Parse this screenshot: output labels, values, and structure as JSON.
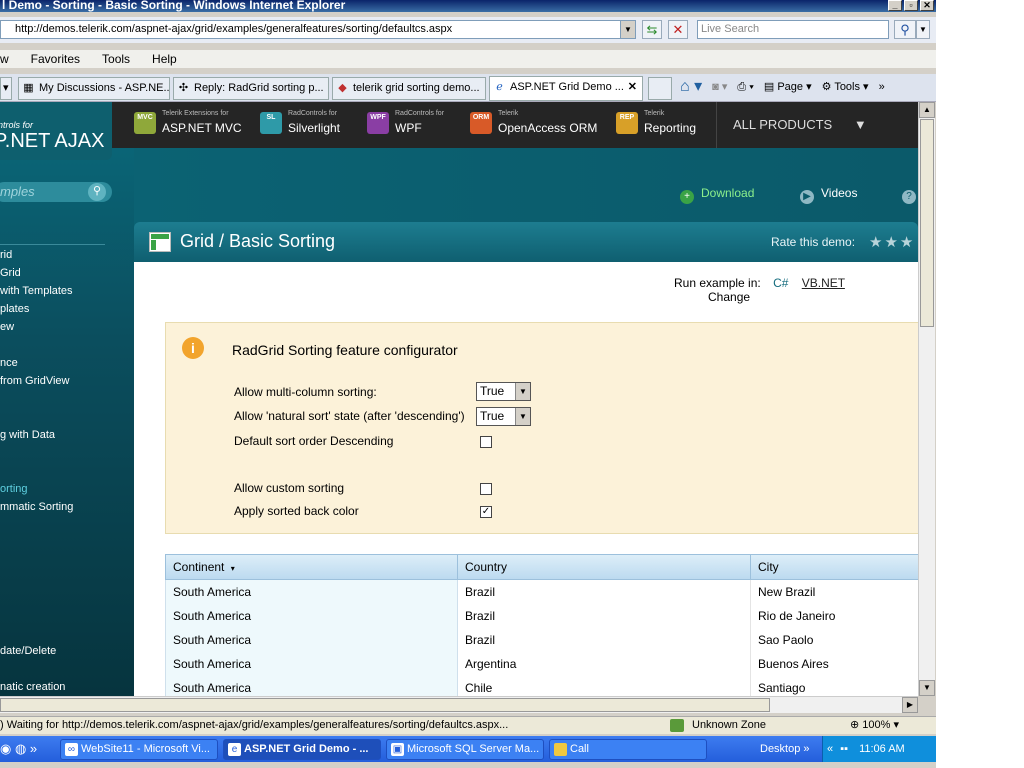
{
  "window": {
    "title": "l Demo - Sorting - Basic Sorting - Windows Internet Explorer"
  },
  "address": {
    "url": "http://demos.telerik.com/aspnet-ajax/grid/examples/generalfeatures/sorting/defaultcs.aspx"
  },
  "live_search": {
    "placeholder": "Live Search"
  },
  "menu": [
    "w",
    "Favorites",
    "Tools",
    "Help"
  ],
  "tabs": [
    {
      "label": "My Discussions - ASP.NE...",
      "icon": "forum-icon"
    },
    {
      "label": "Reply: RadGrid sorting p...",
      "icon": "reply-icon"
    },
    {
      "label": "telerik grid sorting demo...",
      "icon": "google-icon"
    },
    {
      "label": "ASP.NET Grid Demo ...",
      "icon": "ie-icon",
      "active": true
    }
  ],
  "toolbar_right": {
    "page": "Page",
    "tools": "Tools"
  },
  "site": {
    "logo_small": "ntrols for",
    "logo_big": "P.NET AJAX",
    "products": [
      {
        "badge": "MVC",
        "small": "Telerik Extensions for",
        "name": "ASP.NET MVC",
        "color": "#8fa83a"
      },
      {
        "badge": "SL",
        "small": "RadControls for",
        "name": "Silverlight",
        "color": "#2e9aa8"
      },
      {
        "badge": "WPF",
        "small": "RadControls for",
        "name": "WPF",
        "color": "#8a3ea4"
      },
      {
        "badge": "ORM",
        "small": "Telerik",
        "name": "OpenAccess ORM",
        "color": "#d85a28"
      },
      {
        "badge": "REP",
        "small": "Telerik",
        "name": "Reporting",
        "color": "#d8a028"
      }
    ],
    "all_products": "ALL PRODUCTS",
    "search_placeholder": "mples",
    "download": "Download",
    "videos": "Videos",
    "sidenav": [
      "rid",
      "Grid",
      " with Templates",
      "plates",
      "ew",
      "",
      "nce",
      "from GridView",
      "",
      "",
      "g with Data",
      "",
      "",
      "orting",
      "mmatic Sorting",
      "",
      "",
      "",
      "",
      "",
      "",
      "",
      "date/Delete",
      "",
      "natic creation"
    ],
    "sidenav_active_index": 13
  },
  "demo": {
    "title": "Grid / Basic Sorting",
    "rate_label": "Rate this demo:",
    "run_in_label": "Run example in:",
    "cs": "C#",
    "vb": "VB.NET",
    "change": "Change"
  },
  "config": {
    "title": "RadGrid Sorting feature configurator",
    "multi_label": "Allow multi-column sorting:",
    "multi_value": "True",
    "natural_label": "Allow 'natural sort' state (after 'descending')",
    "natural_value": "True",
    "desc_label": "Default sort order Descending",
    "desc_checked": false,
    "custom_label": "Allow custom sorting",
    "custom_checked": false,
    "backcolor_label": "Apply sorted back color",
    "backcolor_checked": true
  },
  "grid": {
    "columns": [
      "Continent",
      "Country",
      "City"
    ],
    "rows": [
      [
        "South America",
        "Brazil",
        "New Brazil"
      ],
      [
        "South America",
        "Brazil",
        "Rio de Janeiro"
      ],
      [
        "South America",
        "Brazil",
        "Sao Paolo"
      ],
      [
        "South America",
        "Argentina",
        "Buenos Aires"
      ],
      [
        "South America",
        "Chile",
        "Santiago"
      ]
    ]
  },
  "status": {
    "text": ") Waiting for http://demos.telerik.com/aspnet-ajax/grid/examples/generalfeatures/sorting/defaultcs.aspx...",
    "zone": "Unknown Zone",
    "zoom": "100%"
  },
  "taskbar": {
    "items": [
      {
        "label": "WebSite11 - Microsoft Vi...",
        "icon": "visual-studio-icon"
      },
      {
        "label": "ASP.NET Grid Demo - ...",
        "icon": "ie-icon",
        "active": true
      },
      {
        "label": "Microsoft SQL Server Ma...",
        "icon": "sql-server-icon"
      },
      {
        "label": "Call",
        "icon": "folder-icon"
      }
    ],
    "desktop": "Desktop",
    "time": "11:06 AM"
  }
}
